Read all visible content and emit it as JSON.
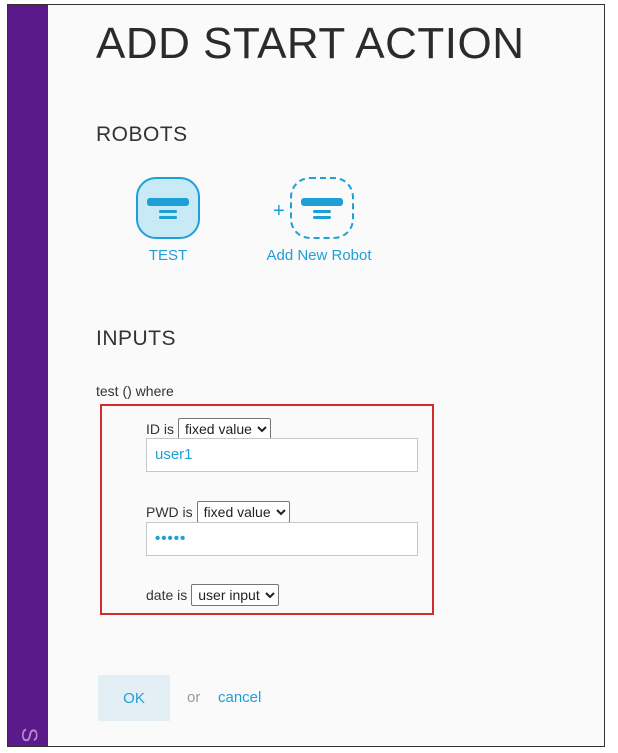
{
  "page": {
    "title": "ADD START ACTION"
  },
  "sidebar": {
    "glyph": "S"
  },
  "robots": {
    "heading": "ROBOTS",
    "items": [
      {
        "label": "TEST",
        "icon": "robot-icon"
      }
    ],
    "add_label": "Add New Robot",
    "add_icon": "add-robot-icon"
  },
  "inputs": {
    "heading": "INPUTS",
    "where_text": "test () where",
    "fields": [
      {
        "label": "ID is",
        "mode": "fixed value",
        "value": "user1"
      },
      {
        "label": "PWD is",
        "mode": "fixed value",
        "value": "•••••"
      },
      {
        "label": "date is",
        "mode": "user input"
      }
    ]
  },
  "actions": {
    "ok_label": "OK",
    "or_text": "or",
    "cancel_label": "cancel"
  },
  "colors": {
    "accent": "#1e9fd6",
    "sidebar": "#5b1a8a",
    "highlight_border": "#d12b2b"
  }
}
